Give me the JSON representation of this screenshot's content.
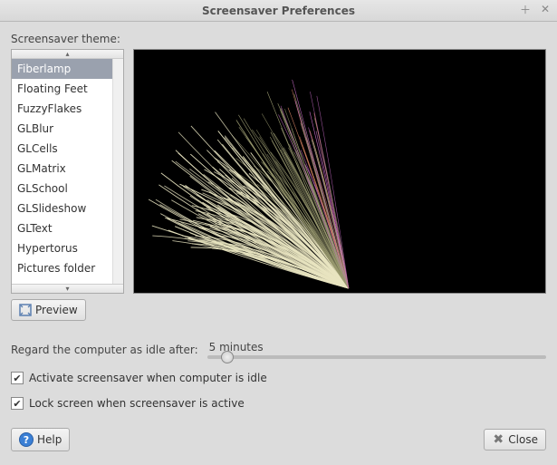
{
  "window": {
    "title": "Screensaver Preferences"
  },
  "labels": {
    "theme_label": "Screensaver theme:",
    "idle_label": "Regard the computer as idle after:",
    "activate_label": "Activate screensaver when computer is idle",
    "lock_label": "Lock screen when screensaver is active"
  },
  "themes": {
    "selected_index": 0,
    "items": [
      "Fiberlamp",
      "Floating Feet",
      "FuzzyFlakes",
      "GLBlur",
      "GLCells",
      "GLMatrix",
      "GLSchool",
      "GLSlideshow",
      "GLText",
      "Hypertorus",
      "Pictures folder"
    ]
  },
  "buttons": {
    "preview": "Preview",
    "help": "Help",
    "close": "Close"
  },
  "idle": {
    "value_text": "5 minutes",
    "value_minutes": 5,
    "thumb_percent": 4
  },
  "checkboxes": {
    "activate": true,
    "lock": true
  }
}
